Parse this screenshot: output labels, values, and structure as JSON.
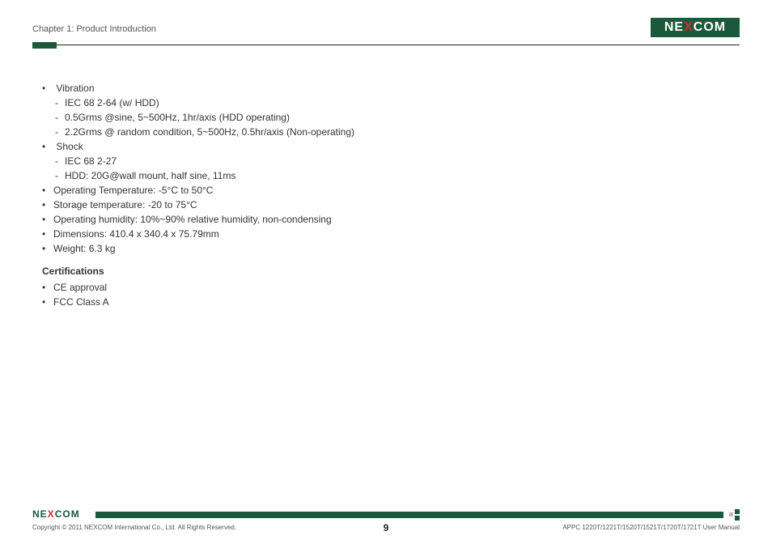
{
  "header": {
    "chapter_title": "Chapter 1: Product Introduction",
    "logo_text_left": "NE",
    "logo_text_x": "X",
    "logo_text_right": "COM"
  },
  "body": {
    "specs": [
      {
        "label": "Vibration",
        "sub": [
          "IEC 68 2-64 (w/ HDD)",
          "0.5Grms @sine, 5~500Hz, 1hr/axis (HDD operating)",
          "2.2Grms @ random condition, 5~500Hz, 0.5hr/axis (Non-operating)"
        ]
      },
      {
        "label": "Shock",
        "sub": [
          "IEC 68 2-27",
          "HDD: 20G@wall mount, half sine, 11ms"
        ]
      },
      {
        "label": "Operating Temperature: -5°C to 50°C"
      },
      {
        "label": "Storage temperature: -20 to 75°C"
      },
      {
        "label": "Operating humidity: 10%~90% relative humidity, non-condensing"
      },
      {
        "label": "Dimensions: 410.4 x 340.4 x 75.79mm"
      },
      {
        "label": "Weight: 6.3 kg"
      }
    ],
    "cert_heading": "Certifications",
    "certs": [
      "CE approval",
      "FCC Class A"
    ]
  },
  "footer": {
    "copyright": "Copyright © 2011 NEXCOM International Co., Ltd. All Rights Reserved.",
    "page_number": "9",
    "manual": "APPC 1220T/1221T/1520T/1521T/1720T/1721T User Manual",
    "logo_text_left": "NE",
    "logo_text_x": "X",
    "logo_text_right": "COM"
  }
}
